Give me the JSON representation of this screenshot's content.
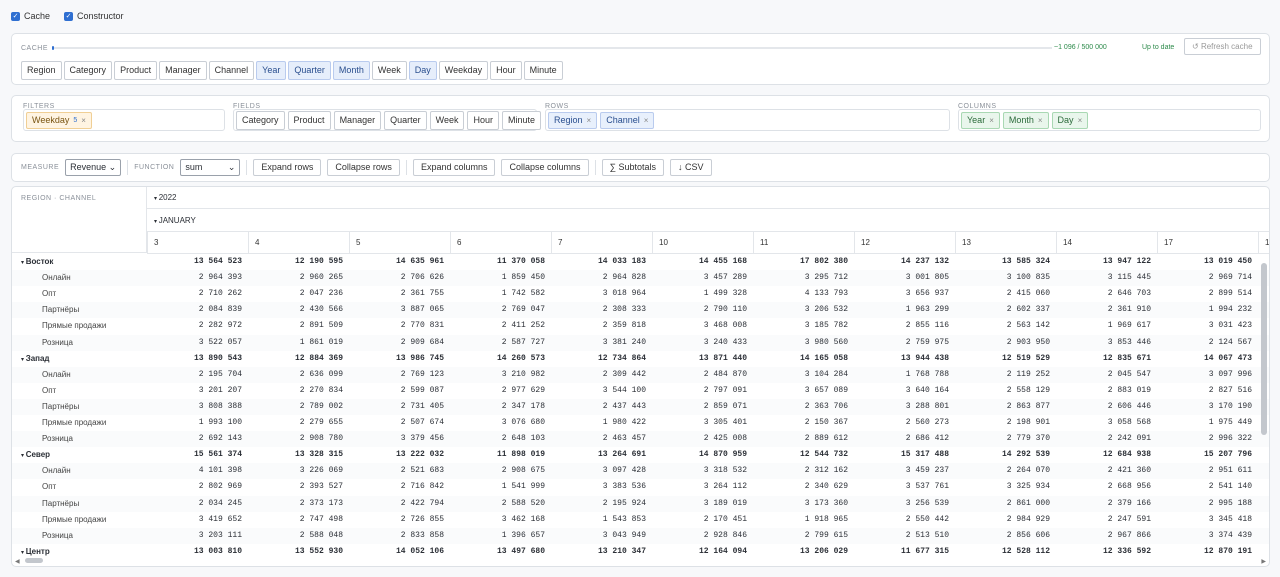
{
  "top": {
    "cache_label": "Cache",
    "constructor_label": "Constructor"
  },
  "cache": {
    "label": "CACHE",
    "count": "~1 096 / 500 000",
    "progress": 0.002,
    "status": "Up to date",
    "refresh": "Refresh cache",
    "dims": [
      {
        "label": "Region",
        "on": false
      },
      {
        "label": "Category",
        "on": false
      },
      {
        "label": "Product",
        "on": false
      },
      {
        "label": "Manager",
        "on": false
      },
      {
        "label": "Channel",
        "on": false
      },
      {
        "label": "Year",
        "on": true
      },
      {
        "label": "Quarter",
        "on": true
      },
      {
        "label": "Month",
        "on": true
      },
      {
        "label": "Week",
        "on": false
      },
      {
        "label": "Day",
        "on": true
      },
      {
        "label": "Weekday",
        "on": false
      },
      {
        "label": "Hour",
        "on": false
      },
      {
        "label": "Minute",
        "on": false
      }
    ]
  },
  "pivot": {
    "filters_label": "FILTERS",
    "fields_label": "FIELDS",
    "rows_label": "ROWS",
    "columns_label": "COLUMNS",
    "filters": [
      {
        "label": "Weekday",
        "badge": "5"
      }
    ],
    "fields": [
      "Category",
      "Product",
      "Manager",
      "Quarter",
      "Week",
      "Hour",
      "Minute"
    ],
    "rows": [
      "Region",
      "Channel"
    ],
    "columns": [
      "Year",
      "Month",
      "Day"
    ]
  },
  "toolbar": {
    "measure_label": "MEASURE",
    "measure": "Revenue",
    "function_label": "FUNCTION",
    "function": "sum",
    "expand_rows": "Expand rows",
    "collapse_rows": "Collapse rows",
    "expand_cols": "Expand columns",
    "collapse_cols": "Collapse columns",
    "subtotals": "∑ Subtotals",
    "csv": "↓ CSV"
  },
  "table": {
    "corner": "REGION · CHANNEL",
    "year": "2022",
    "month": "JANUARY",
    "days": [
      "3",
      "4",
      "5",
      "6",
      "7",
      "10",
      "11",
      "12",
      "13",
      "14",
      "17",
      "18"
    ],
    "rows": [
      {
        "label": "Восток",
        "group": true,
        "v": [
          "13 564 523",
          "12 190 595",
          "14 635 961",
          "11 370 058",
          "14 033 183",
          "14 455 168",
          "17 802 380",
          "14 237 132",
          "13 585 324",
          "13 947 122",
          "13 019 450"
        ]
      },
      {
        "label": "Онлайн",
        "v": [
          "2 964 393",
          "2 960 265",
          "2 706 626",
          "1 859 450",
          "2 964 828",
          "3 457 289",
          "3 295 712",
          "3 001 805",
          "3 100 835",
          "3 115 445",
          "2 969 714"
        ]
      },
      {
        "label": "Опт",
        "v": [
          "2 710 262",
          "2 047 236",
          "2 361 755",
          "1 742 582",
          "3 018 964",
          "1 499 328",
          "4 133 793",
          "3 656 937",
          "2 415 060",
          "2 646 703",
          "2 899 514"
        ]
      },
      {
        "label": "Партнёры",
        "v": [
          "2 084 839",
          "2 430 566",
          "3 887 065",
          "2 769 047",
          "2 308 333",
          "2 790 110",
          "3 206 532",
          "1 963 299",
          "2 602 337",
          "2 361 910",
          "1 994 232"
        ]
      },
      {
        "label": "Прямые продажи",
        "v": [
          "2 282 972",
          "2 891 509",
          "2 770 831",
          "2 411 252",
          "2 359 818",
          "3 468 008",
          "3 185 782",
          "2 855 116",
          "2 563 142",
          "1 969 617",
          "3 031 423"
        ]
      },
      {
        "label": "Розница",
        "v": [
          "3 522 057",
          "1 861 019",
          "2 909 684",
          "2 587 727",
          "3 381 240",
          "3 240 433",
          "3 980 560",
          "2 759 975",
          "2 903 950",
          "3 853 446",
          "2 124 567"
        ]
      },
      {
        "label": "Запад",
        "group": true,
        "v": [
          "13 890 543",
          "12 884 369",
          "13 986 745",
          "14 260 573",
          "12 734 864",
          "13 871 440",
          "14 165 058",
          "13 944 438",
          "12 519 529",
          "12 835 671",
          "14 067 473"
        ]
      },
      {
        "label": "Онлайн",
        "v": [
          "2 195 704",
          "2 636 099",
          "2 769 123",
          "3 210 982",
          "2 309 442",
          "2 484 870",
          "3 104 284",
          "1 768 788",
          "2 119 252",
          "2 045 547",
          "3 097 996"
        ]
      },
      {
        "label": "Опт",
        "v": [
          "3 201 207",
          "2 270 834",
          "2 599 087",
          "2 977 629",
          "3 544 100",
          "2 797 091",
          "3 657 089",
          "3 640 164",
          "2 558 129",
          "2 883 019",
          "2 827 516"
        ]
      },
      {
        "label": "Партнёры",
        "v": [
          "3 808 388",
          "2 789 002",
          "2 731 405",
          "2 347 178",
          "2 437 443",
          "2 859 071",
          "2 363 706",
          "3 288 801",
          "2 863 877",
          "2 606 446",
          "3 170 190"
        ]
      },
      {
        "label": "Прямые продажи",
        "v": [
          "1 993 100",
          "2 279 655",
          "2 507 674",
          "3 076 680",
          "1 980 422",
          "3 305 401",
          "2 150 367",
          "2 560 273",
          "2 198 901",
          "3 058 568",
          "1 975 449"
        ]
      },
      {
        "label": "Розница",
        "v": [
          "2 692 143",
          "2 908 780",
          "3 379 456",
          "2 648 103",
          "2 463 457",
          "2 425 008",
          "2 889 612",
          "2 686 412",
          "2 779 370",
          "2 242 091",
          "2 996 322"
        ]
      },
      {
        "label": "Север",
        "group": true,
        "v": [
          "15 561 374",
          "13 328 315",
          "13 222 032",
          "11 898 019",
          "13 264 691",
          "14 870 959",
          "12 544 732",
          "15 317 488",
          "14 292 539",
          "12 684 938",
          "15 207 796"
        ]
      },
      {
        "label": "Онлайн",
        "v": [
          "4 101 398",
          "3 226 069",
          "2 521 683",
          "2 908 675",
          "3 097 428",
          "3 318 532",
          "2 312 162",
          "3 459 237",
          "2 264 070",
          "2 421 360",
          "2 951 611"
        ]
      },
      {
        "label": "Опт",
        "v": [
          "2 802 969",
          "2 393 527",
          "2 716 842",
          "1 541 999",
          "3 383 536",
          "3 264 112",
          "2 340 629",
          "3 537 761",
          "3 325 934",
          "2 668 956",
          "2 541 140"
        ]
      },
      {
        "label": "Партнёры",
        "v": [
          "2 034 245",
          "2 373 173",
          "2 422 794",
          "2 588 520",
          "2 195 924",
          "3 189 019",
          "3 173 360",
          "3 256 539",
          "2 861 000",
          "2 379 166",
          "2 995 188"
        ]
      },
      {
        "label": "Прямые продажи",
        "v": [
          "3 419 652",
          "2 747 498",
          "2 726 855",
          "3 462 168",
          "1 543 853",
          "2 170 451",
          "1 918 965",
          "2 550 442",
          "2 984 929",
          "2 247 591",
          "3 345 418"
        ]
      },
      {
        "label": "Розница",
        "v": [
          "3 203 111",
          "2 588 048",
          "2 833 858",
          "1 396 657",
          "3 043 949",
          "2 928 846",
          "2 799 615",
          "2 513 510",
          "2 856 606",
          "2 967 866",
          "3 374 439"
        ]
      },
      {
        "label": "Центр",
        "group": true,
        "v": [
          "13 003 810",
          "13 552 930",
          "14 052 106",
          "13 497 680",
          "13 210 347",
          "12 164 094",
          "13 206 029",
          "11 677 315",
          "12 528 112",
          "12 336 592",
          "12 870 191"
        ]
      }
    ]
  }
}
